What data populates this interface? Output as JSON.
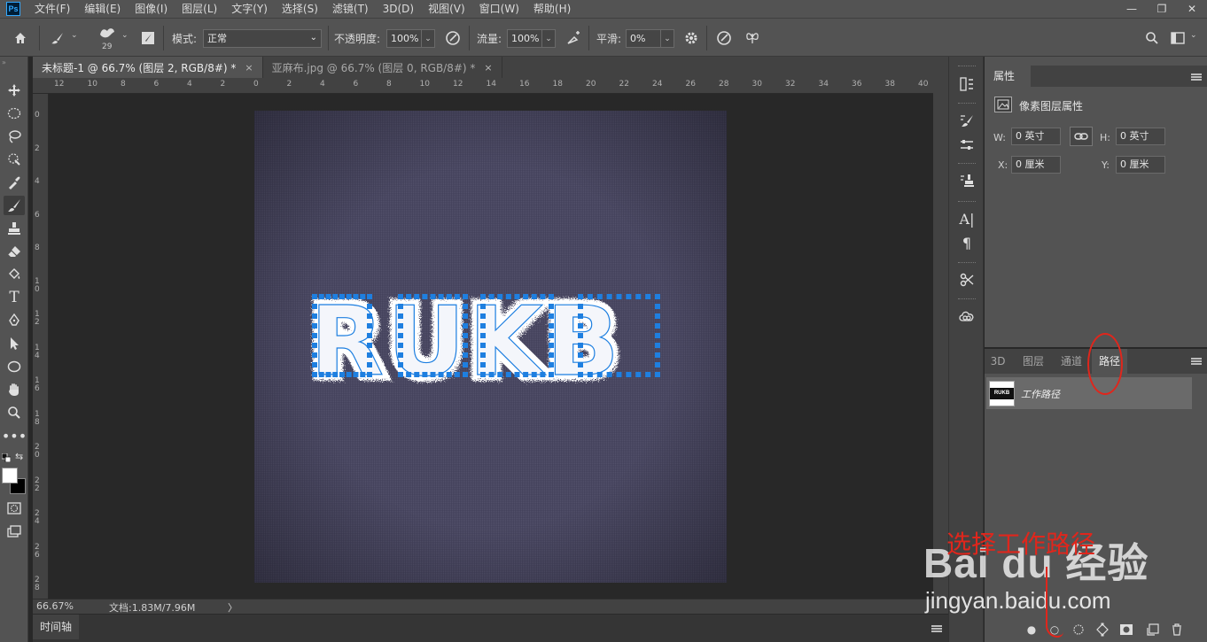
{
  "app": {
    "logo": "Ps"
  },
  "menu": [
    "文件(F)",
    "编辑(E)",
    "图像(I)",
    "图层(L)",
    "文字(Y)",
    "选择(S)",
    "滤镜(T)",
    "3D(D)",
    "视图(V)",
    "窗口(W)",
    "帮助(H)"
  ],
  "window_controls": {
    "minimize": "—",
    "restore": "❐",
    "close": "✕"
  },
  "options": {
    "brush_size": "29",
    "mode_label": "模式:",
    "mode_value": "正常",
    "opacity_label": "不透明度:",
    "opacity_value": "100%",
    "flow_label": "流量:",
    "flow_value": "100%",
    "smooth_label": "平滑:",
    "smooth_value": "0%"
  },
  "tabs": [
    {
      "label": "未标题-1 @ 66.7% (图层 2, RGB/8#) *",
      "close": "×",
      "active": true
    },
    {
      "label": "亚麻布.jpg @ 66.7% (图层 0, RGB/8#) *",
      "close": "×",
      "active": false
    }
  ],
  "ruler_top": [
    "12",
    "10",
    "8",
    "6",
    "4",
    "2",
    "0",
    "2",
    "4",
    "6",
    "8",
    "10",
    "12",
    "14",
    "16",
    "18",
    "20",
    "22",
    "24",
    "26",
    "28",
    "30",
    "32",
    "34",
    "36",
    "38",
    "40"
  ],
  "ruler_left": [
    "0",
    "2",
    "4",
    "6",
    "8",
    "1 0",
    "1 2",
    "1 4",
    "1 6",
    "1 8",
    "2 0",
    "2 2",
    "2 4",
    "2 6",
    "2 8"
  ],
  "canvas_text": "RUKB",
  "status": {
    "zoom": "66.67%",
    "doc": "文档:1.83M/7.96M",
    "arrow": "〉"
  },
  "timeline_label": "时间轴",
  "colors": {
    "ui_dark": "#282828",
    "panel": "#535353",
    "canvas_fabric": "#484660",
    "path_blue": "#1e7fe0",
    "annotation_red": "#e0261c"
  },
  "properties": {
    "tab": "属性",
    "title": "像素图层属性",
    "w_label": "W:",
    "w_value": "0 英寸",
    "h_label": "H:",
    "h_value": "0 英寸",
    "x_label": "X:",
    "x_value": "0 厘米",
    "y_label": "Y:",
    "y_value": "0 厘米"
  },
  "panels": {
    "tabs": [
      "3D",
      "图层",
      "通道",
      "路径"
    ],
    "active_tab": "路径",
    "path_name": "工作路径",
    "path_thumb_text": "RUKB"
  },
  "annotation": {
    "text": "选择工作路径"
  },
  "watermark": {
    "logo": "Baidu 经验",
    "url": "jingyan.baidu.com"
  }
}
